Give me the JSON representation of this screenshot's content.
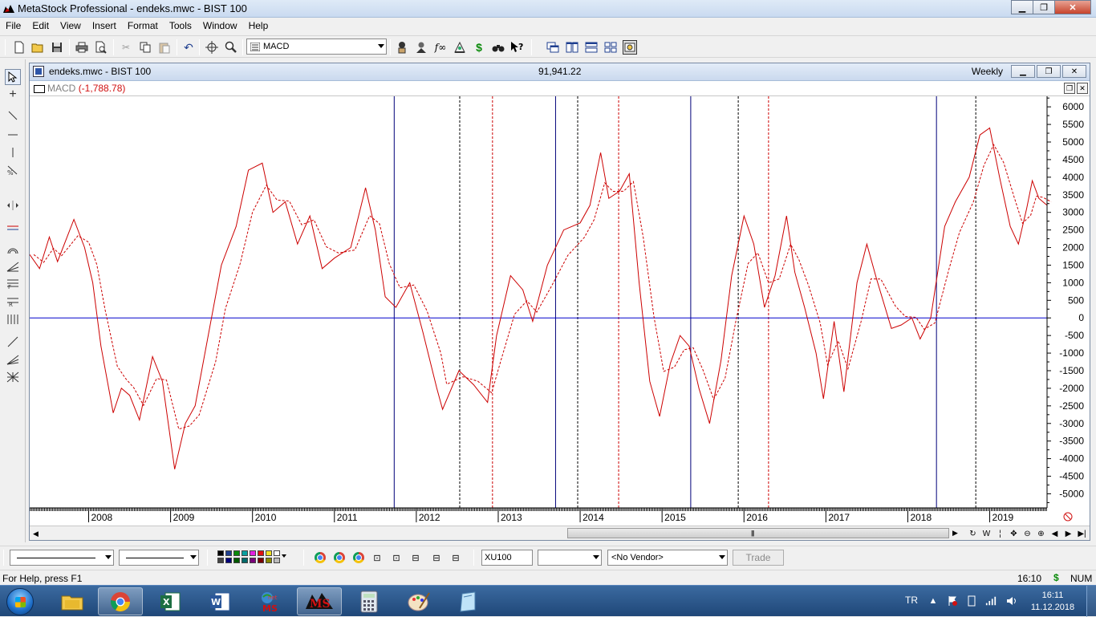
{
  "window": {
    "title": "MetaStock Professional - endeks.mwc - BIST 100",
    "minimize": "▁",
    "restore": "❐",
    "close": "✕"
  },
  "menu": [
    "File",
    "Edit",
    "View",
    "Insert",
    "Format",
    "Tools",
    "Window",
    "Help"
  ],
  "toolbar": {
    "indicator_value": "MACD"
  },
  "chart_window": {
    "title": "endeks.mwc - BIST 100",
    "last_value": "91,941.22",
    "periodicity": "Weekly",
    "indicator_name": "MACD",
    "indicator_value": "(-1,788.78)"
  },
  "chart_data": {
    "type": "line",
    "x_labels": [
      "2008",
      "2009",
      "2010",
      "2011",
      "2012",
      "2013",
      "2014",
      "2015",
      "2016",
      "2017",
      "2018",
      "2019"
    ],
    "y_ticks": [
      6000,
      5500,
      5000,
      4500,
      4000,
      3500,
      3000,
      2500,
      2000,
      1500,
      1000,
      500,
      0,
      -500,
      -1000,
      -1500,
      -2000,
      -2500,
      -3000,
      -3500,
      -4000,
      -4500,
      -5000
    ],
    "ylim": [
      -5400,
      6300
    ],
    "xlim": [
      2007.28,
      2019.7
    ],
    "grid": false,
    "colors": {
      "macd": "#cc0000",
      "signal": "#cc0000",
      "zero_line": "#0000cc",
      "blue_markers": "#00007a",
      "red_markers": "#cc0000",
      "black_markers": "#000000"
    },
    "series": [
      {
        "style": "solid",
        "points": [
          [
            2007.28,
            1800
          ],
          [
            2007.4,
            1400
          ],
          [
            2007.52,
            2300
          ],
          [
            2007.62,
            1600
          ],
          [
            2007.82,
            2800
          ],
          [
            2007.95,
            2000
          ],
          [
            2008.05,
            1000
          ],
          [
            2008.15,
            -800
          ],
          [
            2008.3,
            -2700
          ],
          [
            2008.4,
            -2000
          ],
          [
            2008.5,
            -2200
          ],
          [
            2008.62,
            -2900
          ],
          [
            2008.78,
            -1100
          ],
          [
            2008.9,
            -1800
          ],
          [
            2009.05,
            -4300
          ],
          [
            2009.18,
            -3000
          ],
          [
            2009.3,
            -2500
          ],
          [
            2009.5,
            0
          ],
          [
            2009.62,
            1500
          ],
          [
            2009.8,
            2600
          ],
          [
            2009.95,
            4200
          ],
          [
            2010.12,
            4400
          ],
          [
            2010.25,
            3000
          ],
          [
            2010.4,
            3300
          ],
          [
            2010.55,
            2100
          ],
          [
            2010.7,
            2900
          ],
          [
            2010.85,
            1400
          ],
          [
            2011.0,
            1700
          ],
          [
            2011.2,
            2000
          ],
          [
            2011.38,
            3700
          ],
          [
            2011.5,
            2500
          ],
          [
            2011.62,
            600
          ],
          [
            2011.75,
            300
          ],
          [
            2011.92,
            1000
          ],
          [
            2012.08,
            -400
          ],
          [
            2012.25,
            -2000
          ],
          [
            2012.32,
            -2600
          ],
          [
            2012.52,
            -1500
          ],
          [
            2012.7,
            -1900
          ],
          [
            2012.87,
            -2400
          ],
          [
            2012.98,
            -500
          ],
          [
            2013.15,
            1200
          ],
          [
            2013.3,
            800
          ],
          [
            2013.42,
            -100
          ],
          [
            2013.6,
            1500
          ],
          [
            2013.8,
            2500
          ],
          [
            2014.0,
            2700
          ],
          [
            2014.12,
            3200
          ],
          [
            2014.25,
            4700
          ],
          [
            2014.35,
            3400
          ],
          [
            2014.48,
            3600
          ],
          [
            2014.6,
            4100
          ],
          [
            2014.72,
            1000
          ],
          [
            2014.85,
            -1800
          ],
          [
            2014.97,
            -2800
          ],
          [
            2015.1,
            -1300
          ],
          [
            2015.22,
            -500
          ],
          [
            2015.33,
            -800
          ],
          [
            2015.45,
            -2000
          ],
          [
            2015.58,
            -3000
          ],
          [
            2015.72,
            -1200
          ],
          [
            2015.85,
            1200
          ],
          [
            2016.0,
            2900
          ],
          [
            2016.12,
            2100
          ],
          [
            2016.25,
            300
          ],
          [
            2016.38,
            1200
          ],
          [
            2016.52,
            2900
          ],
          [
            2016.62,
            1300
          ],
          [
            2016.74,
            300
          ],
          [
            2016.88,
            -1000
          ],
          [
            2016.97,
            -2300
          ],
          [
            2017.1,
            -100
          ],
          [
            2017.22,
            -2100
          ],
          [
            2017.38,
            1000
          ],
          [
            2017.5,
            2100
          ],
          [
            2017.62,
            1100
          ],
          [
            2017.8,
            -300
          ],
          [
            2017.92,
            -200
          ],
          [
            2018.05,
            0
          ],
          [
            2018.15,
            -600
          ],
          [
            2018.28,
            0
          ],
          [
            2018.45,
            2600
          ],
          [
            2018.58,
            3300
          ],
          [
            2018.75,
            4000
          ],
          [
            2018.88,
            5200
          ],
          [
            2019.0,
            5400
          ],
          [
            2019.12,
            4000
          ],
          [
            2019.25,
            2600
          ],
          [
            2019.35,
            2100
          ],
          [
            2019.45,
            3100
          ],
          [
            2019.52,
            3900
          ],
          [
            2019.6,
            3400
          ],
          [
            2019.7,
            3200
          ]
        ]
      }
    ]
  },
  "bottom_toolbar": {
    "symbol": "XU100",
    "vendor": "<No Vendor>",
    "trade_label": "Trade"
  },
  "status": {
    "help": "For Help, press F1",
    "time": "16:10",
    "dollar": "$",
    "num": "NUM"
  },
  "taskbar": {
    "language": "TR",
    "clock_time": "16:11",
    "clock_date": "11.12.2018"
  }
}
